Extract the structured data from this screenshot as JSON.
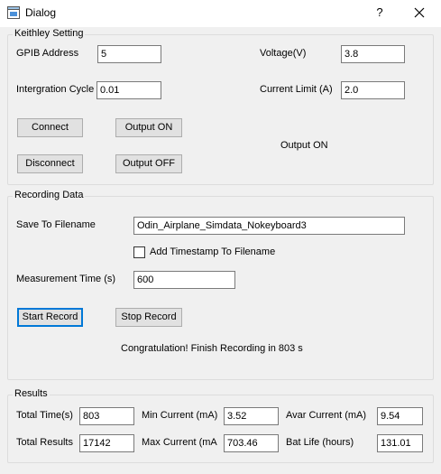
{
  "window": {
    "title": "Dialog",
    "help": "?",
    "icon": "window-app-icon"
  },
  "keithley": {
    "legend": "Keithley Setting",
    "gpib_label": "GPIB Address",
    "gpib_value": "5",
    "voltage_label": "Voltage(V)",
    "voltage_value": "3.8",
    "cycle_label": "Intergration Cycle",
    "cycle_value": "0.01",
    "current_limit_label": "Current Limit (A)",
    "current_limit_value": "2.0",
    "connect": "Connect",
    "disconnect": "Disconnect",
    "output_on": "Output ON",
    "output_off": "Output OFF",
    "output_status": "Output ON"
  },
  "recording": {
    "legend": "Recording Data",
    "filename_label": "Save To Filename",
    "filename_value": "Odin_Airplane_Simdata_Nokeyboard3",
    "timestamp_label": "Add  Timestamp To Filename",
    "timestamp_checked": false,
    "measurement_label": "Measurement Time (s)",
    "measurement_value": "600",
    "start": "Start Record",
    "stop": "Stop Record",
    "status": "Congratulation! Finish Recording in 803 s"
  },
  "results": {
    "legend": "Results",
    "total_time_label": "Total Time(s)",
    "total_time_value": "803",
    "min_current_label": "Min Current (mA)",
    "min_current_value": "3.52",
    "avar_current_label": "Avar Current (mA)",
    "avar_current_value": "9.54",
    "total_results_label": "Total Results",
    "total_results_value": "17142",
    "max_current_label": "Max Current (mA",
    "max_current_value": "703.46",
    "bat_life_label": "Bat Life (hours)",
    "bat_life_value": "131.01"
  }
}
